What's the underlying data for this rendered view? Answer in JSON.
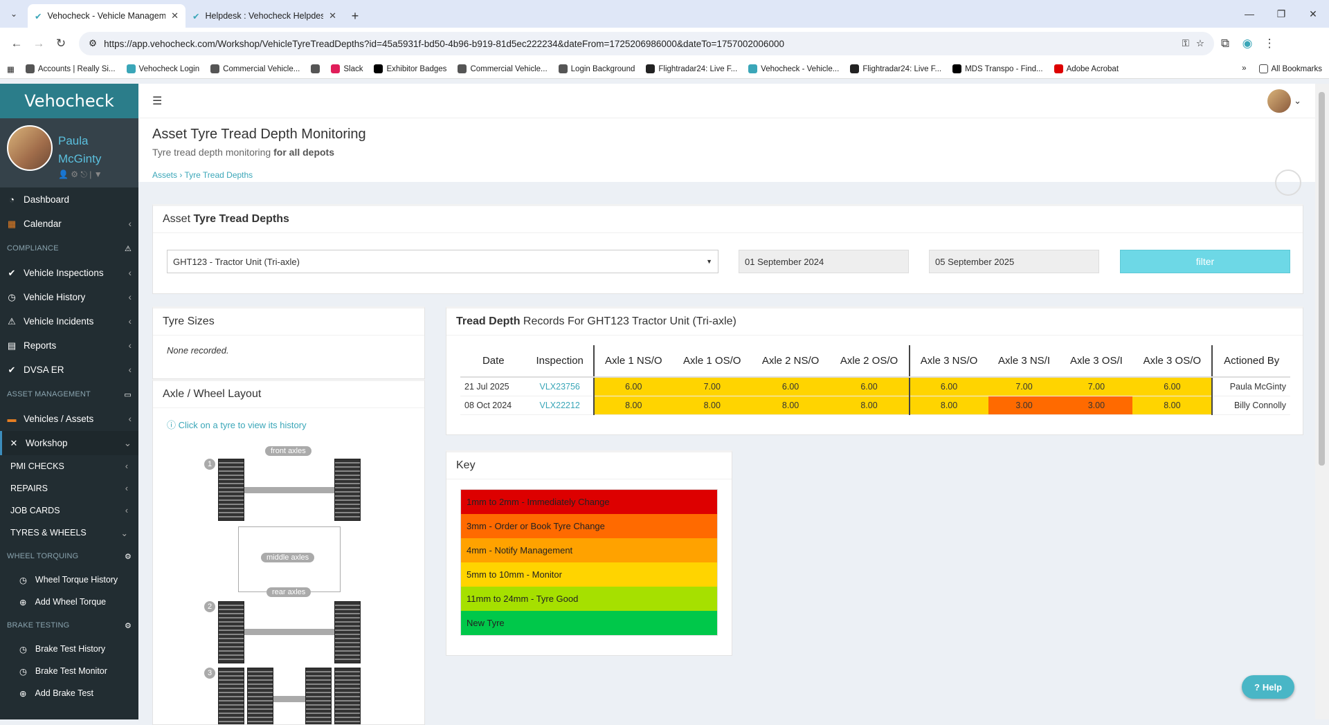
{
  "browser": {
    "tabs": [
      {
        "title": "Vehocheck - Vehicle Manageme"
      },
      {
        "title": "Helpdesk : Vehocheck Helpdesk"
      }
    ],
    "url": "https://app.vehocheck.com/Workshop/VehicleTyreTreadDepths?id=45a5931f-bd50-4b96-b919-81d5ec222234&dateFrom=1725206986000&dateTo=1757002006000",
    "bookmarks": [
      "Accounts | Really Si...",
      "Vehocheck Login",
      "Commercial Vehicle...",
      "",
      "Slack",
      "Exhibitor Badges",
      "Commercial Vehicle...",
      "Login Background",
      "Flightradar24: Live F...",
      "Vehocheck - Vehicle...",
      "Flightradar24: Live F...",
      "MDS Transpo - Find...",
      "Adobe Acrobat"
    ],
    "all_bookmarks": "All Bookmarks"
  },
  "sidebar": {
    "logo": "Vehocheck",
    "user": {
      "first": "Paula",
      "last": "McGinty"
    },
    "items": {
      "dashboard": "Dashboard",
      "calendar": "Calendar",
      "compliance": "COMPLIANCE",
      "vehicle_inspections": "Vehicle Inspections",
      "vehicle_history": "Vehicle History",
      "vehicle_incidents": "Vehicle Incidents",
      "reports": "Reports",
      "dvsa_er": "DVSA ER",
      "asset_management": "ASSET MANAGEMENT",
      "vehicles_assets": "Vehicles / Assets",
      "workshop": "Workshop",
      "pmi_checks": "PMI CHECKS",
      "repairs": "REPAIRS",
      "job_cards": "JOB CARDS",
      "tyres_wheels": "TYRES & WHEELS",
      "wheel_torquing": "WHEEL TORQUING",
      "wheel_torque_history": "Wheel Torque History",
      "add_wheel_torque": "Add Wheel Torque",
      "brake_testing": "BRAKE TESTING",
      "brake_test_history": "Brake Test History",
      "brake_test_monitor": "Brake Test Monitor",
      "add_brake_test": "Add Brake Test"
    }
  },
  "page": {
    "title": "Asset Tyre Tread Depth Monitoring",
    "subtitle_a": "Tyre tread depth monitoring",
    "subtitle_b": "for all depots",
    "breadcrumb_1": "Assets",
    "breadcrumb_2": "Tyre Tread Depths"
  },
  "filter_box": {
    "title_a": "Asset",
    "title_b": "Tyre Tread Depths",
    "asset": "GHT123 - Tractor Unit (Tri-axle)",
    "date_from": "01 September 2024",
    "date_to": "05 September 2025",
    "filter": "filter"
  },
  "tyre_sizes": {
    "title": "Tyre Sizes",
    "none": "None recorded."
  },
  "layout": {
    "title": "Axle / Wheel Layout",
    "hint": "Click on a tyre to view its history",
    "front": "front axles",
    "middle": "middle axles",
    "rear": "rear axles",
    "n1": "1",
    "n2": "2",
    "n3": "3"
  },
  "records": {
    "title_a": "Tread Depth",
    "title_b": "Records For GHT123 Tractor Unit (Tri-axle)",
    "columns": [
      "Date",
      "Inspection",
      "Axle 1 NS/O",
      "Axle 1 OS/O",
      "Axle 2 NS/O",
      "Axle 2 OS/O",
      "Axle 3 NS/O",
      "Axle 3 NS/I",
      "Axle 3 OS/I",
      "Axle 3 OS/O",
      "Actioned By"
    ],
    "rows": [
      {
        "date": "21 Jul 2025",
        "inspection": "VLX23756",
        "values": [
          "6.00",
          "7.00",
          "6.00",
          "6.00",
          "6.00",
          "7.00",
          "7.00",
          "6.00"
        ],
        "by": "Paula McGinty"
      },
      {
        "date": "08 Oct 2024",
        "inspection": "VLX22212",
        "values": [
          "8.00",
          "8.00",
          "8.00",
          "8.00",
          "8.00",
          "3.00",
          "3.00",
          "8.00"
        ],
        "by": "Billy Connolly"
      }
    ]
  },
  "key": {
    "title": "Key",
    "items": [
      {
        "label": "1mm to 2mm - Immediately Change",
        "color": "#dd0000"
      },
      {
        "label": "3mm - Order or Book Tyre Change",
        "color": "#ff6a00"
      },
      {
        "label": "4mm - Notify Management",
        "color": "#ffa200"
      },
      {
        "label": "5mm to 10mm - Monitor",
        "color": "#ffd400"
      },
      {
        "label": "11mm to 24mm - Tyre Good",
        "color": "#a6e000"
      },
      {
        "label": "New Tyre",
        "color": "#00c84a"
      }
    ]
  },
  "help": "Help"
}
